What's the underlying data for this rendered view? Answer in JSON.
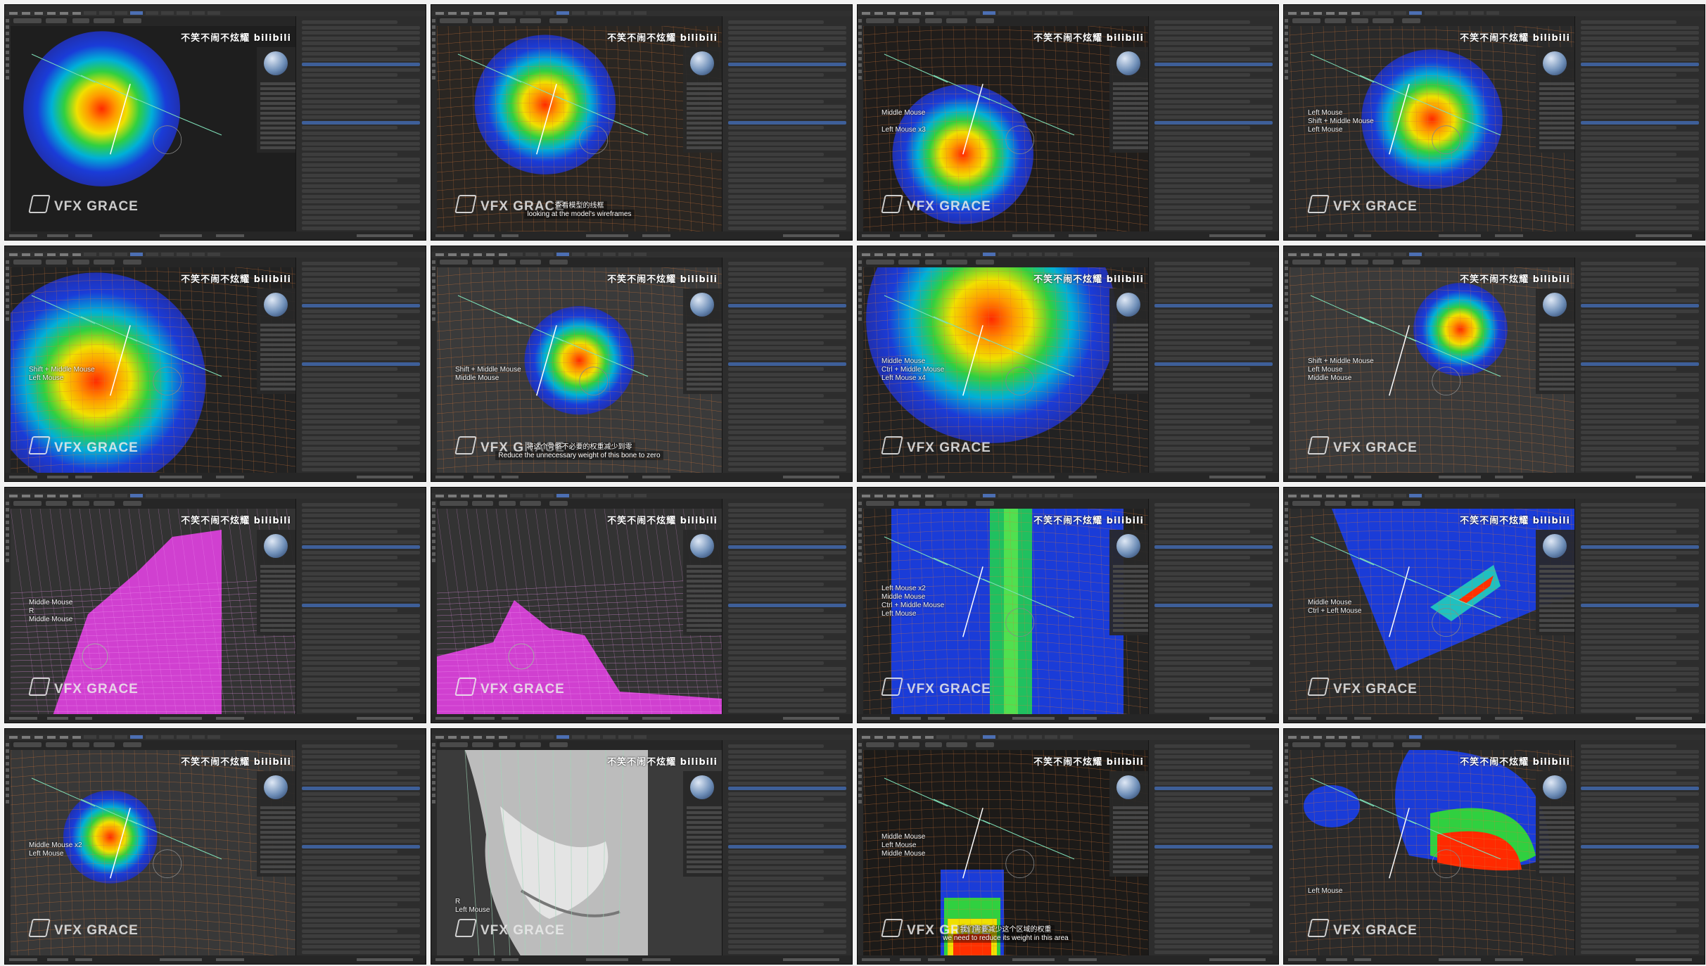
{
  "watermarks": {
    "bilibili": "不笑不闹不炫耀 bilibili",
    "vfx": "VFX GRACE"
  },
  "tiles": [
    {
      "keys": "",
      "sub_cn": "",
      "sub_en": ""
    },
    {
      "keys": "",
      "sub_cn": "查看模型的线框",
      "sub_en": "looking at the model's wireframes"
    },
    {
      "keys": "Middle Mouse\n\nLeft Mouse x3",
      "sub_cn": "",
      "sub_en": ""
    },
    {
      "keys": "Left Mouse\nShift + Middle Mouse\nLeft Mouse",
      "sub_cn": "",
      "sub_en": ""
    },
    {
      "keys": "Shift + Middle Mouse\nLeft Mouse",
      "sub_cn": "",
      "sub_en": ""
    },
    {
      "keys": "Shift + Middle Mouse\nMiddle Mouse",
      "sub_cn": "将这个骨骼不必要的权重减少到零",
      "sub_en": "Reduce the unnecessary weight of this bone to zero"
    },
    {
      "keys": "Middle Mouse\nCtrl + Middle Mouse\nLeft Mouse x4",
      "sub_cn": "",
      "sub_en": ""
    },
    {
      "keys": "Shift + Middle Mouse\nLeft Mouse\nMiddle Mouse",
      "sub_cn": "",
      "sub_en": ""
    },
    {
      "keys": "Middle Mouse\nR\nMiddle Mouse",
      "sub_cn": "",
      "sub_en": ""
    },
    {
      "keys": "",
      "sub_cn": "",
      "sub_en": ""
    },
    {
      "keys": "Left Mouse x2\nMiddle Mouse\nCtrl + Middle Mouse\nLeft Mouse",
      "sub_cn": "",
      "sub_en": ""
    },
    {
      "keys": "Middle Mouse\nCtrl + Left Mouse",
      "sub_cn": "",
      "sub_en": ""
    },
    {
      "keys": "Middle Mouse x2\nLeft Mouse",
      "sub_cn": "",
      "sub_en": ""
    },
    {
      "keys": "R\nLeft Mouse",
      "sub_cn": "",
      "sub_en": ""
    },
    {
      "keys": "Middle Mouse\nLeft Mouse\nMiddle Mouse",
      "sub_cn": "我们需要减少这个区域的权重",
      "sub_en": "we need to reduce its weight in this area"
    },
    {
      "keys": "Left Mouse",
      "sub_cn": "",
      "sub_en": ""
    }
  ]
}
